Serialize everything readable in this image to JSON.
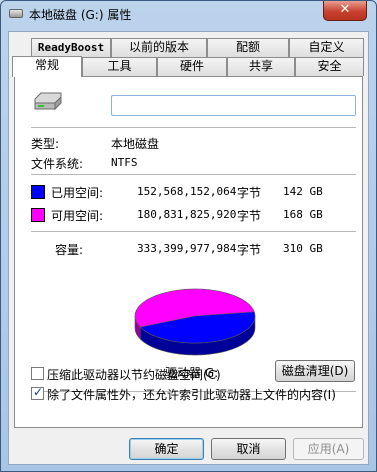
{
  "window": {
    "title": "本地磁盘 (G:) 属性",
    "close_label": "✕"
  },
  "tabs": {
    "row1": [
      "ReadyBoost",
      "以前的版本",
      "配额",
      "自定义"
    ],
    "row2": [
      "常规",
      "工具",
      "硬件",
      "共享",
      "安全"
    ],
    "active": "常规"
  },
  "general": {
    "drive_name_value": "",
    "type_label": "类型:",
    "type_value": "本地磁盘",
    "fs_label": "文件系统:",
    "fs_value": "NTFS",
    "used": {
      "label": "已用空间:",
      "bytes": "152,568,152,064",
      "unit": "字节",
      "size": "142 GB",
      "color": "#0000ff"
    },
    "free": {
      "label": "可用空间:",
      "bytes": "180,831,825,920",
      "unit": "字节",
      "size": "168 GB",
      "color": "#ff00ff"
    },
    "capacity": {
      "label": "容量:",
      "bytes": "333,399,977,984",
      "unit": "字节",
      "size": "310 GB"
    },
    "drive_label": "驱动器 G:",
    "cleanup_button": "磁盘清理(D)",
    "compress_label": "压缩此驱动器以节约磁盘空间(C)",
    "compress_checked": false,
    "index_label": "除了文件属性外，还允许索引此驱动器上文件的内容(I)",
    "index_checked": true
  },
  "footer": {
    "ok": "确定",
    "cancel": "取消",
    "apply": "应用(A)"
  },
  "chart_data": {
    "type": "pie",
    "categories": [
      "已用空间",
      "可用空间"
    ],
    "values": [
      142,
      168
    ],
    "colors": [
      "#0000ff",
      "#ff00ff"
    ]
  }
}
